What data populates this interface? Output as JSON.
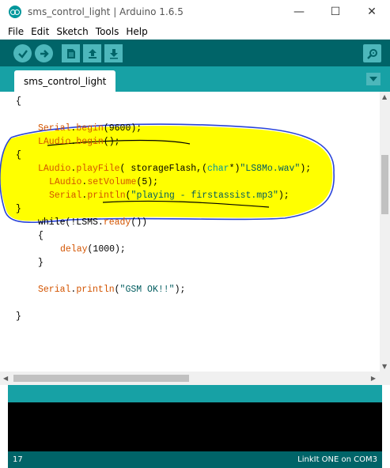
{
  "window": {
    "title": "sms_control_light | Arduino 1.6.5",
    "minimize": "—",
    "maximize": "☐",
    "close": "✕"
  },
  "menu": [
    "File",
    "Edit",
    "Sketch",
    "Tools",
    "Help"
  ],
  "toolbar": {
    "buttons": [
      "verify-icon",
      "upload-icon",
      "new-icon",
      "open-icon",
      "save-icon",
      "serial-monitor-icon"
    ]
  },
  "tab": {
    "label": "sms_control_light"
  },
  "code": {
    "l1": "{",
    "l2_kw": "Serial",
    "l2_dot": ".",
    "l2_fn": "begin",
    "l2_rest": "(9600);",
    "l3_kw": "LAudio",
    "l3_dot": ".",
    "l3_fn": "begin",
    "l3_rest": "();",
    "l4": "{",
    "l5_kw": "LAudio",
    "l5_dot": ".",
    "l5_fn": "playFile",
    "l5_a": "( storageFlash,(",
    "l5_ty": "char",
    "l5_b": "*)",
    "l5_str": "\"LS8Mo.wav\"",
    "l5_c": ");",
    "l6_kw": "LAudio",
    "l6_dot": ".",
    "l6_fn": "setVolume",
    "l6_rest": "(5);",
    "l7_kw": "Serial",
    "l7_dot": ".",
    "l7_fn": "println",
    "l7_a": "(",
    "l7_str": "\"playing - firstassist.mp3\"",
    "l7_b": ");",
    "l8": "}",
    "l9_a": "while(!LSMS.",
    "l9_fn": "ready",
    "l9_b": "())",
    "l10": "{",
    "l11_fn": "delay",
    "l11_rest": "(1000);",
    "l12": "}",
    "l13_kw": "Serial",
    "l13_dot": ".",
    "l13_fn": "println",
    "l13_a": "(",
    "l13_str": "\"GSM OK!!\"",
    "l13_b": ");",
    "l14": "}"
  },
  "status": {
    "line": "17",
    "board": "LinkIt ONE on COM3"
  },
  "colors": {
    "toolbar": "#006468",
    "tabbar": "#17a1a5",
    "highlight": "#ffff00",
    "annotation": "#2a44d8"
  }
}
